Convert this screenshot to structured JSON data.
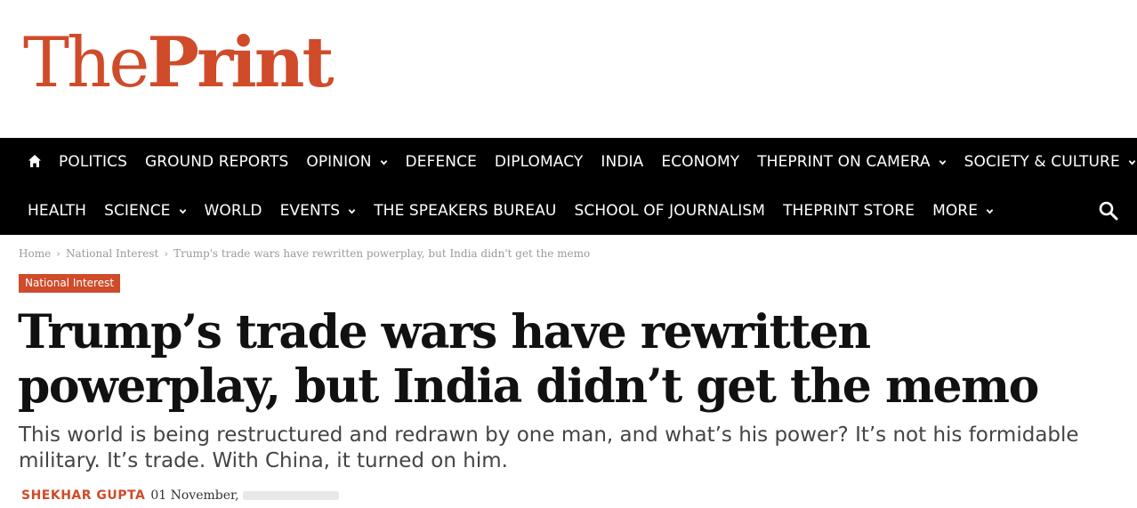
{
  "logo": {
    "part1": "The",
    "part2": "Print"
  },
  "nav": {
    "row1": [
      {
        "label": "POLITICS",
        "dropdown": false
      },
      {
        "label": "GROUND REPORTS",
        "dropdown": false
      },
      {
        "label": "OPINION",
        "dropdown": true
      },
      {
        "label": "DEFENCE",
        "dropdown": false
      },
      {
        "label": "DIPLOMACY",
        "dropdown": false
      },
      {
        "label": "INDIA",
        "dropdown": false
      },
      {
        "label": "ECONOMY",
        "dropdown": false
      },
      {
        "label": "THEPRINT ON CAMERA",
        "dropdown": true
      },
      {
        "label": "SOCIETY & CULTURE",
        "dropdown": true
      }
    ],
    "row2": [
      {
        "label": "HEALTH",
        "dropdown": false
      },
      {
        "label": "SCIENCE",
        "dropdown": true
      },
      {
        "label": "WORLD",
        "dropdown": false
      },
      {
        "label": "EVENTS",
        "dropdown": true
      },
      {
        "label": "THE SPEAKERS BUREAU",
        "dropdown": false
      },
      {
        "label": "SCHOOL OF JOURNALISM",
        "dropdown": false
      },
      {
        "label": "THEPRINT STORE",
        "dropdown": false
      },
      {
        "label": "MORE",
        "dropdown": true
      }
    ],
    "icons": {
      "home": "home-icon",
      "search": "search-icon",
      "dropdown": "chevron-down-icon"
    }
  },
  "breadcrumb": {
    "home": "Home",
    "category": "National Interest",
    "current": "Trump's trade wars have rewritten powerplay, but India didn't get the memo",
    "separator": "›"
  },
  "article": {
    "category_badge": "National Interest",
    "headline": "Trump’s trade wars have rewritten powerplay, but India didn’t get the memo",
    "dek": "This world is being restructured and redrawn by one man, and what’s his power? It’s not his formidable military. It’s trade. With China, it turned on him.",
    "author": "SHEKHAR GUPTA",
    "date": "01 November,"
  },
  "colors": {
    "brand": "#cf4b2a",
    "nav_bg": "#000000",
    "text": "#111111"
  }
}
